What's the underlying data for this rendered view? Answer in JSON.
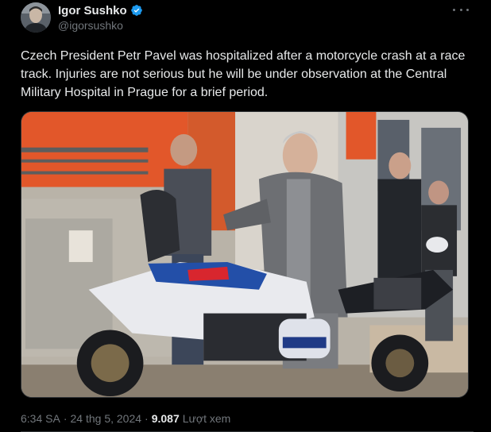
{
  "author": {
    "display_name": "Igor Sushko",
    "handle": "@igorsushko",
    "verified": true,
    "avatar_icon": "profile-photo"
  },
  "post": {
    "text": "Czech President Petr Pavel was hospitalized after a motorcycle crash at a race track. Injuries are not serious but he will be under observation at the Central Military Hospital in Prague for a brief period.",
    "image_alt": "photo"
  },
  "meta": {
    "time": "6:34 SA",
    "separator": "·",
    "date": "24 thg 5, 2024",
    "views_count": "9.087",
    "views_label": "Lượt xem"
  },
  "icons": {
    "more": "more-icon",
    "verified": "verified-badge-icon"
  },
  "colors": {
    "background": "#000000",
    "text_primary": "#e7e9ea",
    "text_secondary": "#71767b",
    "verified_blue": "#1d9bf0",
    "border": "#2f3336"
  }
}
